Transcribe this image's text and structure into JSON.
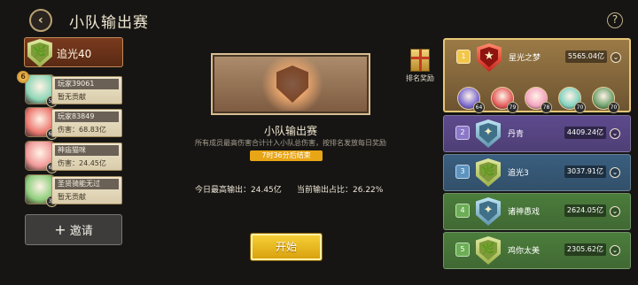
{
  "header": {
    "title": "小队输出赛",
    "back_icon": "‹",
    "help": "?"
  },
  "my_team": {
    "name": "追光40",
    "emblem_icon": "🌿",
    "members": [
      {
        "name": "玩家39061",
        "info": "暂无贡献",
        "level": "50",
        "rank": "6",
        "color": "#8fd6b7"
      },
      {
        "name": "玩家83849",
        "info": "伤害：68.83亿",
        "level": "66",
        "rank": "",
        "color": "#ec7a72"
      },
      {
        "name": "神庙猫咪",
        "info": "伤害：24.45亿",
        "level": "65",
        "rank": "",
        "color": "#f19a9a"
      },
      {
        "name": "圣贤骑能无过",
        "info": "暂无贡献",
        "level": "37",
        "rank": "",
        "color": "#8fce7e"
      }
    ],
    "invite_label": "邀请",
    "invite_icon": "+"
  },
  "event": {
    "title": "小队输出赛",
    "description": "所有成员最高伤害合计计入小队总伤害，按排名发放每日奖励",
    "timer": "7时36分后结束",
    "today_max": "今日最高输出：24.45亿",
    "current_ratio": "当前输出占比：26.22%",
    "start_label": "开始"
  },
  "reward": {
    "label": "排名奖励",
    "icon": "gift-icon"
  },
  "leaderboard": [
    {
      "rank": "1",
      "name": "星光之梦",
      "score": "5565.04亿",
      "shield": "red",
      "emblem": "★",
      "bg": "#8a6c3d",
      "num_bg": "#f1c64a",
      "avatars": [
        {
          "level": "64",
          "color": "#7b6ad0"
        },
        {
          "level": "79",
          "color": "#e25a5a"
        },
        {
          "level": "78",
          "color": "#f4a3c0"
        },
        {
          "level": "70",
          "color": "#7fd1c0"
        },
        {
          "level": "70",
          "color": "#6da06b"
        }
      ]
    },
    {
      "rank": "2",
      "name": "丹青",
      "score": "4409.24亿",
      "shield": "blue",
      "emblem": "✦",
      "bg": "#5d4a8e",
      "num_bg": "#8b77c8"
    },
    {
      "rank": "3",
      "name": "追光3",
      "score": "3037.91亿",
      "shield": "green",
      "emblem": "🌿",
      "bg": "#3a5f80",
      "num_bg": "#5d93bf"
    },
    {
      "rank": "4",
      "name": "诸神愚戏",
      "score": "2624.05亿",
      "shield": "blue",
      "emblem": "✦",
      "bg": "#4c7e3c",
      "num_bg": "#6cae55"
    },
    {
      "rank": "5",
      "name": "鸡你太美",
      "score": "2305.62亿",
      "shield": "green",
      "emblem": "🌿",
      "bg": "#4c7e3c",
      "num_bg": "#6cae55"
    }
  ],
  "colors": {
    "accent_gold": "#e8a516",
    "panel_dark": "#161514"
  }
}
